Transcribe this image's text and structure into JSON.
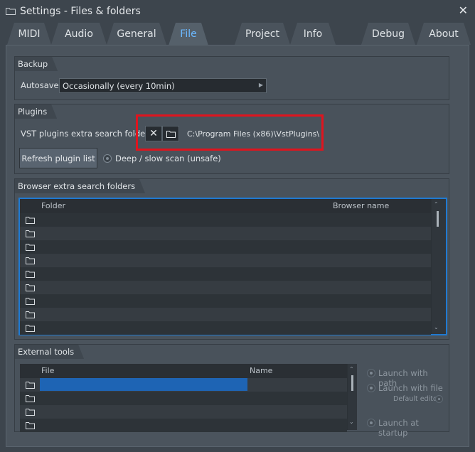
{
  "window": {
    "title": "Settings - Files & folders",
    "close_glyph": "✕"
  },
  "tabs": [
    {
      "label": "MIDI"
    },
    {
      "label": "Audio"
    },
    {
      "label": "General"
    },
    {
      "label": "File",
      "active": true
    },
    {
      "label": "Project"
    },
    {
      "label": "Info"
    },
    {
      "label": "Debug"
    },
    {
      "label": "About"
    }
  ],
  "backup": {
    "title": "Backup",
    "autosave_label": "Autosave",
    "autosave_value": "Occasionally (every 10min)"
  },
  "plugins": {
    "title": "Plugins",
    "vst_label": "VST plugins extra search folder",
    "clear_glyph": "✕",
    "vst_path": "C:\\Program Files (x86)\\VstPlugins\\",
    "refresh_label": "Refresh plugin list",
    "deep_scan_label": "Deep / slow scan (unsafe)"
  },
  "browser": {
    "title": "Browser extra search folders",
    "col_folder": "Folder",
    "col_browser_name": "Browser name",
    "row_count": 9
  },
  "external_tools": {
    "title": "External tools",
    "col_file": "File",
    "col_name": "Name",
    "launch_with_path": "Launch with path",
    "launch_with_file": "Launch with file",
    "default_editor": "Default editor",
    "launch_at_startup": "Launch at startup"
  },
  "colors": {
    "accent_tab": "#6bb8ff",
    "highlight_box": "#e0141e",
    "selection": "#1e64b4",
    "list_focus": "#1f7ad2"
  },
  "icons": {
    "window": "folder-icon",
    "close": "close-icon",
    "clear": "clear-x-icon",
    "browse": "folder-icon",
    "row": "folder-icon"
  }
}
